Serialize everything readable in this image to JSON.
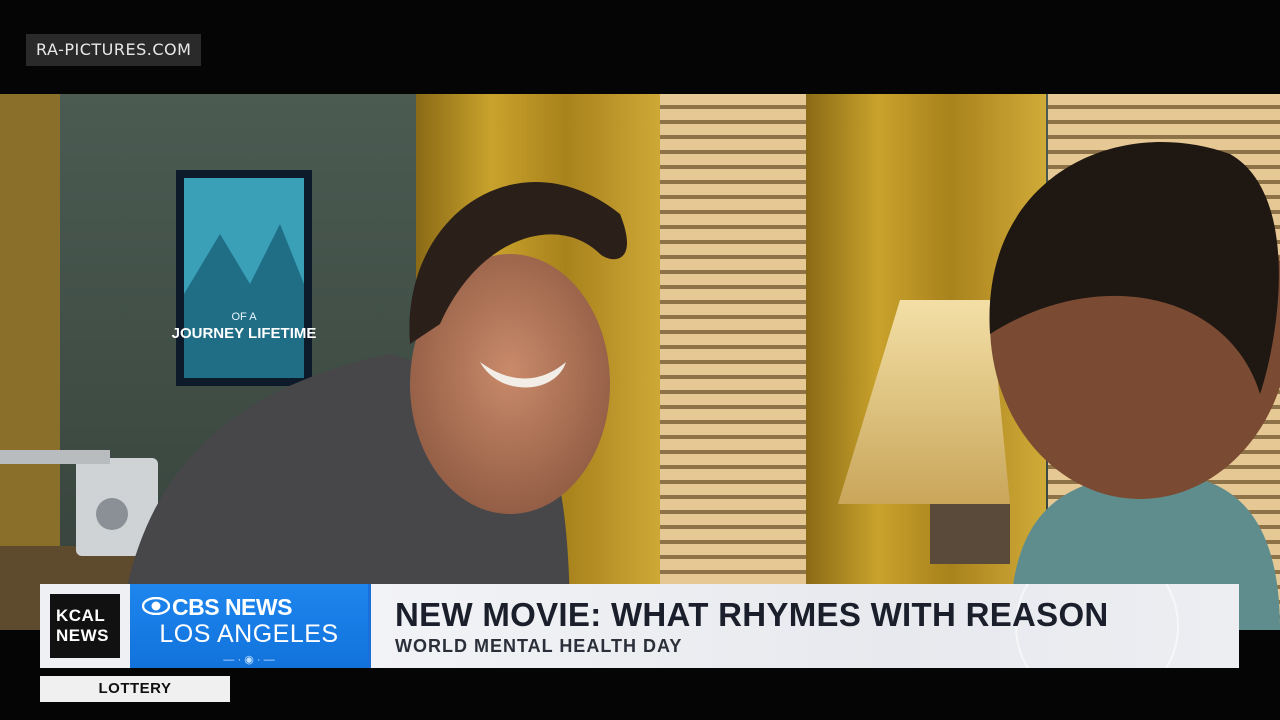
{
  "watermark": "RA-PICTURES.COM",
  "scene": {
    "poster_title": "JOURNEY LIFETIME",
    "poster_sub": "OF A"
  },
  "lower_third": {
    "station_logo": [
      "KCAL",
      "NEWS"
    ],
    "network": "CBS NEWS",
    "city": "LOS ANGELES",
    "headline": "NEW MOVIE: WHAT RHYMES WITH REASON",
    "subhead": "WORLD MENTAL HEALTH DAY"
  },
  "ticker": {
    "label": "LOTTERY"
  },
  "colors": {
    "cbs_blue": "#1a7de8",
    "lower_third_bg": "#eceef2",
    "letterbox": "#050505"
  }
}
